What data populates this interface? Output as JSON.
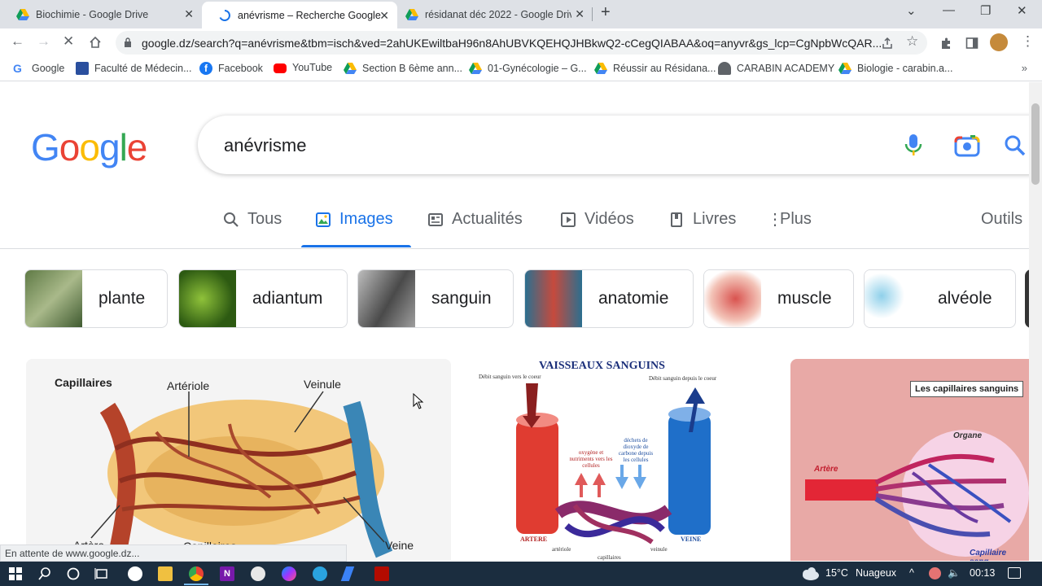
{
  "tabs": [
    {
      "title": "Biochimie - Google Drive",
      "icon": "drive-icon"
    },
    {
      "title": "anévrisme – Recherche Google",
      "icon": "loading-icon",
      "active": true
    },
    {
      "title": "résidanat déc 2022 - Google Drive",
      "icon": "drive-icon"
    }
  ],
  "address": {
    "url": "google.dz/search?q=anévrisme&tbm=isch&ved=2ahUKEwiltbaH96n8AhUBVKQEHQJHBkwQ2-cCegQIABAA&oq=anyvr&gs_lcp=CgNpbWcQAR..."
  },
  "bookmarks": [
    {
      "label": "Google",
      "icon": "google-g-icon"
    },
    {
      "label": "Faculté de Médecin...",
      "icon": "faculty-icon"
    },
    {
      "label": "Facebook",
      "icon": "facebook-icon"
    },
    {
      "label": "YouTube",
      "icon": "youtube-icon"
    },
    {
      "label": "Section B 6ème ann...",
      "icon": "drive-icon"
    },
    {
      "label": "01-Gynécologie – G...",
      "icon": "drive-icon"
    },
    {
      "label": "Réussir au Résidana...",
      "icon": "drive-icon"
    },
    {
      "label": "CARABIN ACADEMY",
      "icon": "carabin-icon"
    },
    {
      "label": "Biologie - carabin.a...",
      "icon": "drive-icon"
    }
  ],
  "search": {
    "query": "anévrisme"
  },
  "nav": [
    {
      "label": "Tous",
      "icon": "search-icon"
    },
    {
      "label": "Images",
      "icon": "image-icon",
      "active": true
    },
    {
      "label": "Actualités",
      "icon": "news-icon"
    },
    {
      "label": "Vidéos",
      "icon": "video-icon"
    },
    {
      "label": "Livres",
      "icon": "book-icon"
    },
    {
      "label": "Plus",
      "icon": "more-vert-icon"
    },
    {
      "label": "Outils",
      "icon": ""
    }
  ],
  "chips": [
    {
      "label": "plante"
    },
    {
      "label": "adiantum"
    },
    {
      "label": "sanguin"
    },
    {
      "label": "anatomie"
    },
    {
      "label": "muscle"
    },
    {
      "label": "alvéole"
    }
  ],
  "results": {
    "card1": {
      "labels": [
        "Capillaires",
        "Artériole",
        "Veinule",
        "Veine",
        "Artère",
        "Capillaires"
      ]
    },
    "card2": {
      "title": "VAISSEAUX SANGUINS",
      "left_note": "Débit sanguin vers le coeur",
      "right_note": "Débit sanguin depuis le coeur",
      "oxy_note": "oxygène et nutriments vers les cellules",
      "waste_note": "déchets de dioxyde de carbone depuis les cellules",
      "artere": "ARTERE",
      "veine": "VEINE",
      "arteriole": "artériole",
      "veinule": "veinule",
      "capillaires": "capillaires"
    },
    "card3": {
      "badge": "Les capillaires sanguins",
      "organe": "Organe",
      "artere": "Artère",
      "capillaire": "Capillaire sang..."
    }
  },
  "status_text": "En attente de www.google.dz...",
  "tray": {
    "temperature": "15°C",
    "weather": "Nuageux",
    "time": "00:13"
  }
}
